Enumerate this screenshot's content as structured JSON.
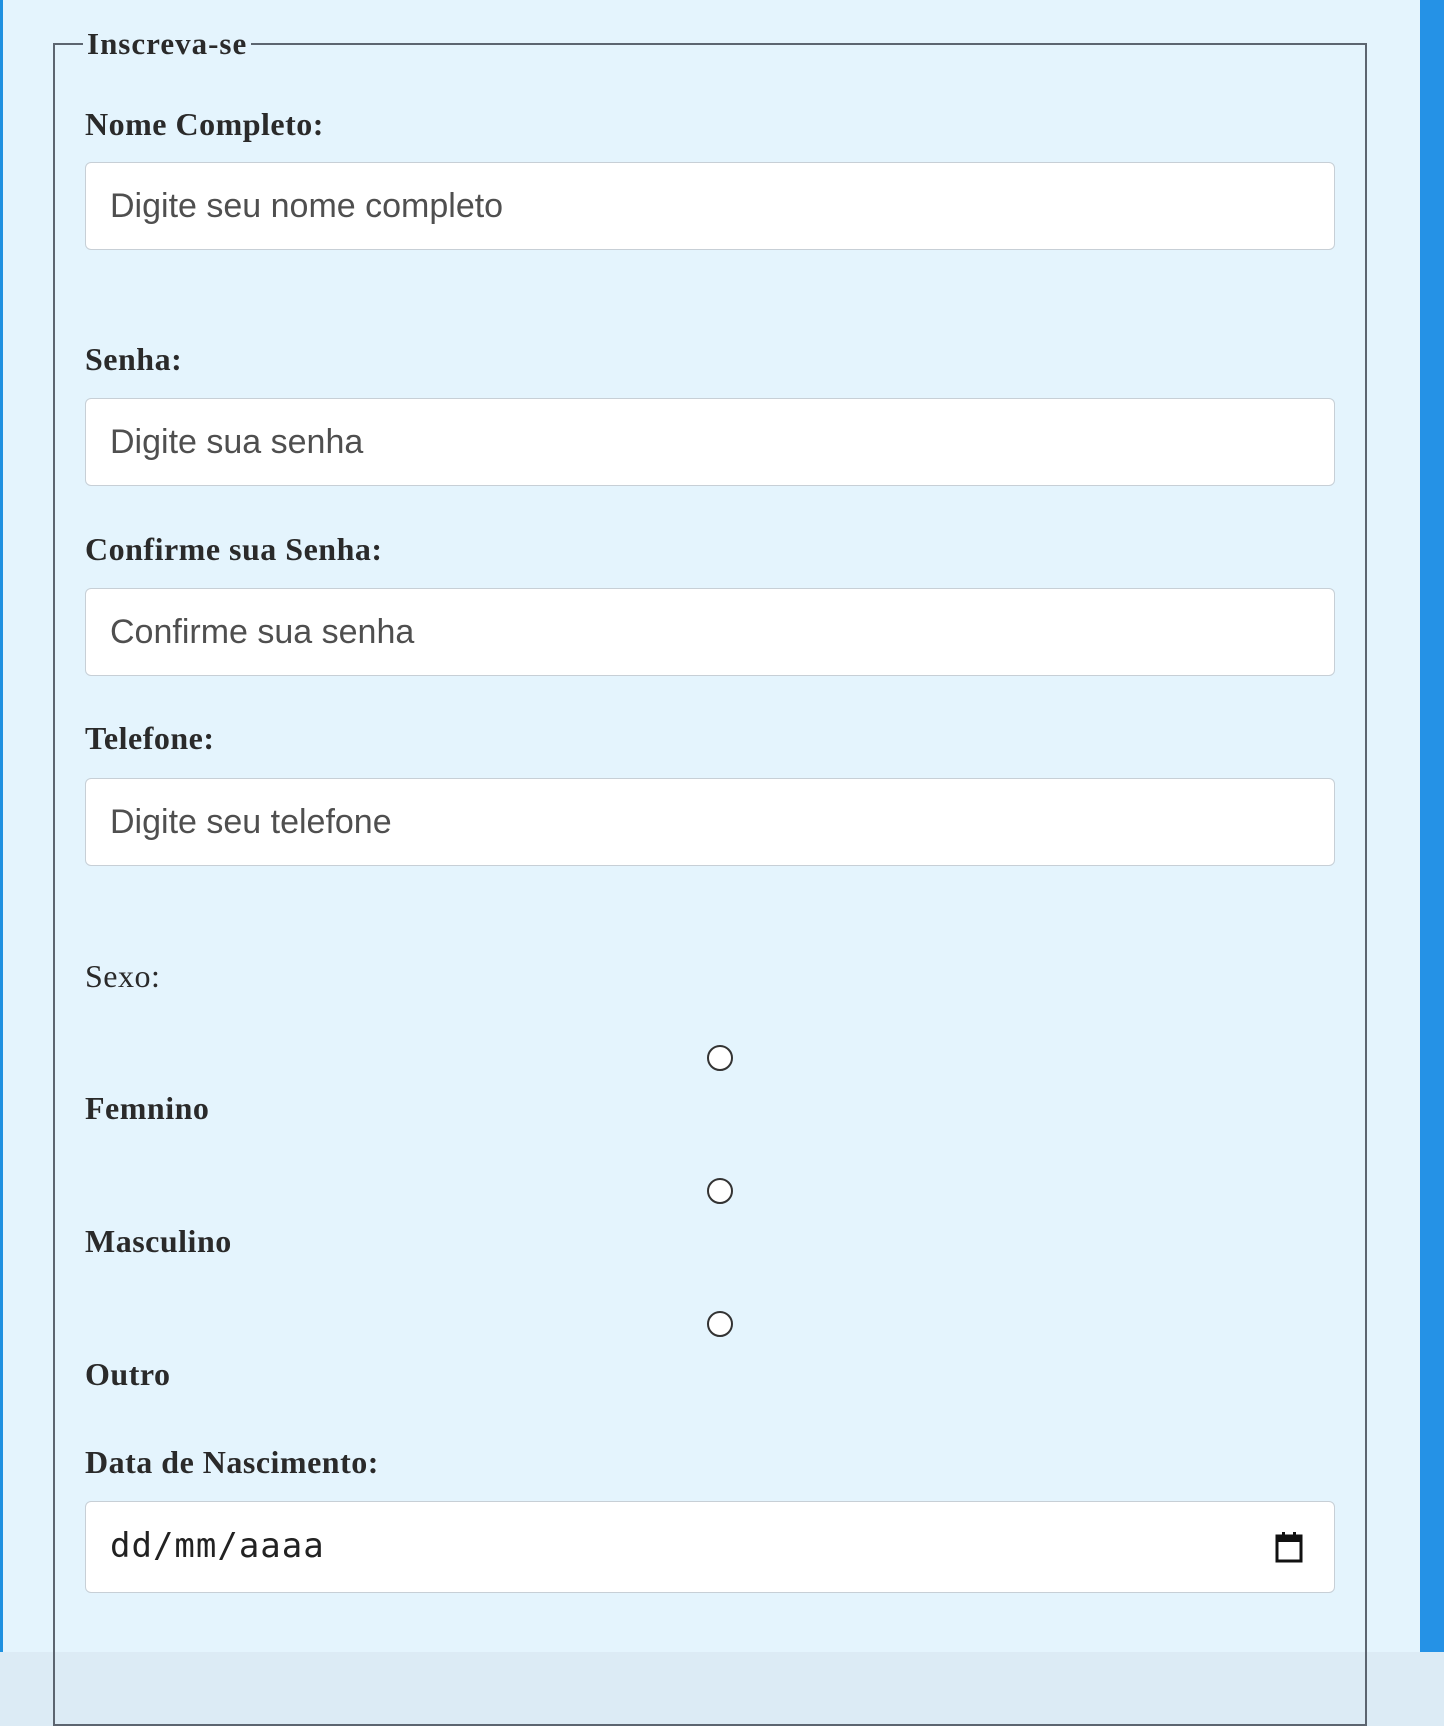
{
  "form": {
    "legend": "Inscreva-se",
    "full_name": {
      "label": "Nome Completo:",
      "placeholder": "Digite seu nome completo"
    },
    "password": {
      "label": "Senha:",
      "placeholder": "Digite sua senha"
    },
    "confirm_password": {
      "label": "Confirme sua Senha:",
      "placeholder": "Confirme sua senha"
    },
    "phone": {
      "label": "Telefone:",
      "placeholder": "Digite seu telefone"
    },
    "sex": {
      "label": "Sexo:",
      "options": [
        {
          "label": "Femnino"
        },
        {
          "label": "Masculino"
        },
        {
          "label": "Outro"
        }
      ]
    },
    "birth_date": {
      "label": "Data de Nascimento:",
      "placeholder": "dd/mm/aaaa",
      "icon": "calendar-icon"
    }
  },
  "colors": {
    "panel_background": "#e4f4fd",
    "page_edge": "#2592e6",
    "fieldset_border": "#5c6570"
  }
}
